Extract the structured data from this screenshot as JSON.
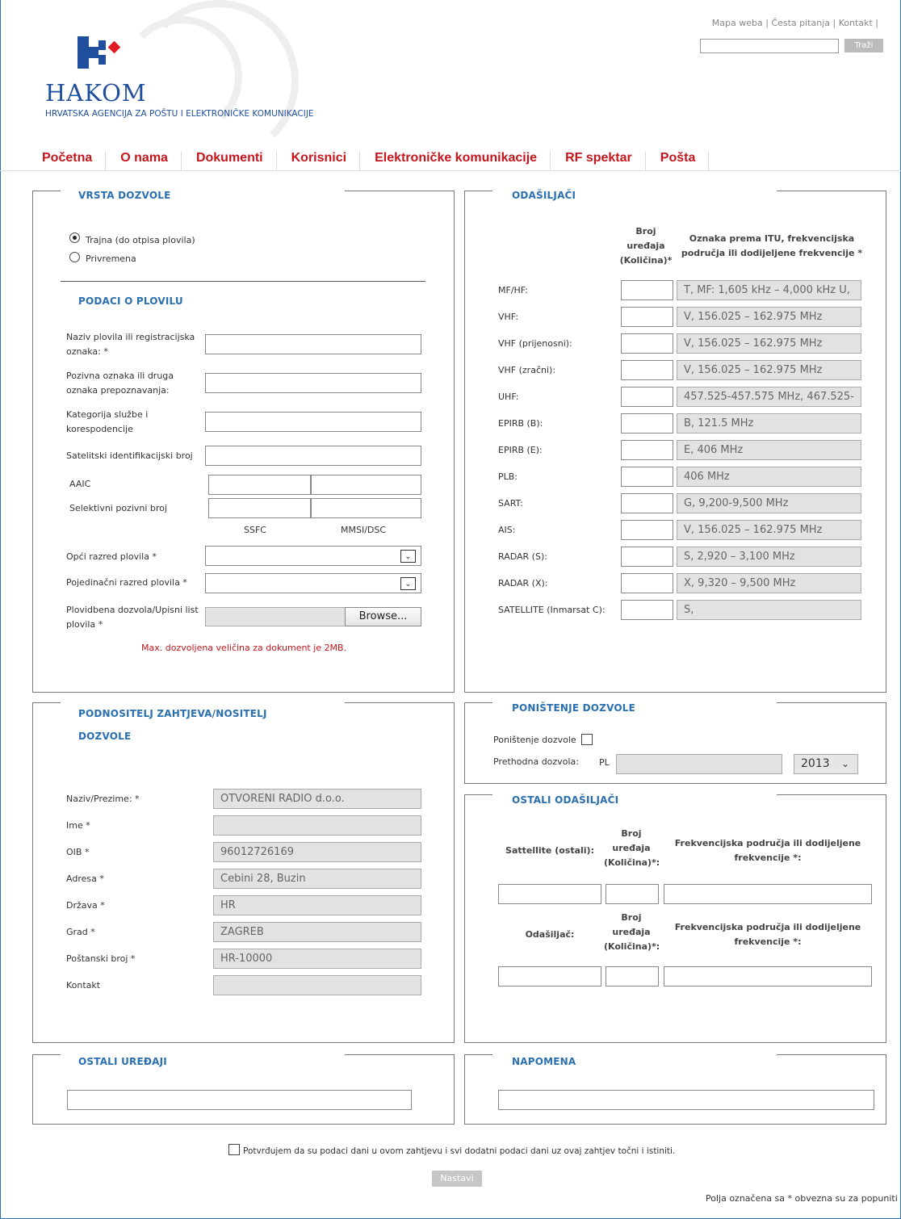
{
  "header": {
    "top_links": "Mapa weba | Česta pitanja | Kontakt |",
    "search_button": "Traži",
    "brand": "HAKOM",
    "tagline": "HRVATSKA AGENCIJA ZA POŠTU I ELEKTRONIČKE KOMUNIKACIJE",
    "nav": [
      "Početna",
      "O nama",
      "Dokumenti",
      "Korisnici",
      "Elektroničke komunikacije",
      "RF spektar",
      "Pošta"
    ]
  },
  "colors": {
    "accent_red": "#c4161c",
    "accent_blue": "#2a6fb0"
  },
  "vrsta": {
    "title": "VRSTA DOZVOLE",
    "radio_trajna": "Trajna (do otpisa plovila)",
    "radio_privremena": "Privremena"
  },
  "plovilo": {
    "title": "PODACI O PLOVILU",
    "naziv_1": "Naziv plovila ili registracijska",
    "naziv_2": "oznaka: *",
    "pozivna_1": "Pozivna oznaka ili druga",
    "pozivna_2": "oznaka prepoznavanja:",
    "kategorija_1": "Kategorija službe i",
    "kategorija_2": "korespodencije",
    "satelitski": "Satelitski identifikacijski broj",
    "aaic": "AAIC",
    "selektivni": "Selektivni pozivni broj",
    "ssfc": "SSFC",
    "mmsi": "MMSI/DSC",
    "opci": "Opći razred plovila *",
    "pojedinacni": "Pojedinačni razred plovila *",
    "dozvola_1": "Plovidbena dozvola/Upisni list",
    "dozvola_2": "plovila *",
    "browse": "Browse...",
    "max_note": "Max. dozvoljena veličina za dokument je 2MB."
  },
  "odasiljaci": {
    "title": "ODAŠILJAČI",
    "col_broj_1": "Broj",
    "col_broj_2": "uređaja",
    "col_broj_3": "(Količina)*",
    "col_oznaka_1": "Oznaka prema ITU, frekvencijska",
    "col_oznaka_2": "područja ili dodijeljene frekvencije *",
    "rows": [
      {
        "label": "MF/HF:",
        "value": "T, MF: 1,605 kHz – 4,000 kHz U,"
      },
      {
        "label": "VHF:",
        "value": "V, 156.025 – 162.975 MHz"
      },
      {
        "label": "VHF (prijenosni):",
        "value": "V, 156.025 – 162.975 MHz"
      },
      {
        "label": "VHF (zračni):",
        "value": "V, 156.025 – 162.975 MHz"
      },
      {
        "label": "UHF:",
        "value": "457.525-457.575 MHz, 467.525-"
      },
      {
        "label": "EPIRB (B):",
        "value": "B, 121.5 MHz"
      },
      {
        "label": "EPIRB (E):",
        "value": "E, 406 MHz"
      },
      {
        "label": "PLB:",
        "value": "406 MHz"
      },
      {
        "label": "SART:",
        "value": "G, 9,200-9,500 MHz"
      },
      {
        "label": "AIS:",
        "value": "V, 156.025 – 162.975 MHz"
      },
      {
        "label": "RADAR (S):",
        "value": "S, 2,920 – 3,100 MHz"
      },
      {
        "label": "RADAR (X):",
        "value": "X, 9,320 – 9,500 MHz"
      },
      {
        "label": "SATELLITE (Inmarsat C):",
        "value": "S,"
      }
    ]
  },
  "podnositelj": {
    "title_1": "PODNOSITELJ ZAHTJEVA/NOSITELJ",
    "title_2": "DOZVOLE",
    "rows": [
      {
        "label": "Naziv/Prezime: *",
        "value": "OTVORENI RADIO d.o.o."
      },
      {
        "label": "Ime *",
        "value": ""
      },
      {
        "label": "OIB *",
        "value": "96012726169"
      },
      {
        "label": "Adresa *",
        "value": "Cebini 28, Buzin"
      },
      {
        "label": "Država *",
        "value": "HR"
      },
      {
        "label": "Grad *",
        "value": "ZAGREB"
      },
      {
        "label": "Poštanski broj *",
        "value": "HR-10000"
      },
      {
        "label": "Kontakt",
        "value": ""
      }
    ]
  },
  "ponistenje": {
    "title": "PONIŠTENJE DOZVOLE",
    "checkbox_label": "Poništenje dozvole",
    "prethodna": "Prethodna dozvola:",
    "pl": "PL",
    "year": "2013"
  },
  "ostali_od": {
    "title": "OSTALI ODAŠILJAČI",
    "sat_label": "Sattellite (ostali):",
    "broj_1": "Broj",
    "broj_2": "uređaja",
    "broj_3": "(Količina)*:",
    "frek_1": "Frekvencijska područja ili dodijeljene",
    "frek_2": "frekvencije *:",
    "odasiljac": "Odašiljač:"
  },
  "ostali_ur": {
    "title": "OSTALI UREĐAJI"
  },
  "napomena": {
    "title": "NAPOMENA"
  },
  "footer": {
    "confirm": "Potvrđujem da su podaci dani u ovom zahtjevu i svi dodatni podaci dani uz ovaj zahtjev točni i istiniti.",
    "nastavi": "Nastavi",
    "required_note": "Polja označena sa * obvezna su za popuniti"
  }
}
